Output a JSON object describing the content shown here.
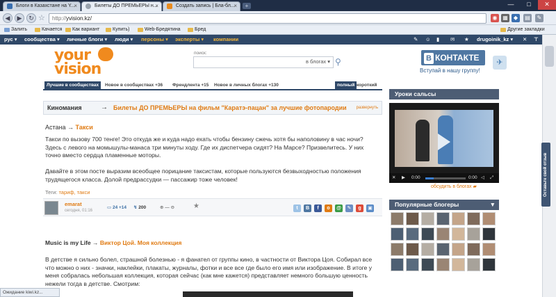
{
  "browser": {
    "tabs": [
      {
        "title": "Блоги в Казахстане на Y...",
        "active": false,
        "favicon_color": "#3a6fb0"
      },
      {
        "title": "Билеты ДО ПРЕМЬЕРЫ н...",
        "active": true,
        "favicon_color": "#9aa3ad"
      },
      {
        "title": "Создать запись | Бла-бл...",
        "active": false,
        "favicon_color": "#e98b1e"
      }
    ],
    "new_tab": "+",
    "window_controls": [
      "—",
      "□",
      "✕"
    ],
    "address": {
      "scheme": "http://",
      "host": "yvision.kz/"
    },
    "bookmarks": [
      "Залить",
      "Качается",
      "Как вариант",
      "Купить)",
      "Web-Бредятина",
      "Бред"
    ],
    "other_bookmarks": "Другие закладки",
    "status": "Ожидание kiwi.kz..."
  },
  "site_menu": {
    "lang": "рус",
    "items": [
      "сообщества",
      "личные блоги",
      "люди",
      "персоны",
      "эксперты",
      "компании"
    ],
    "user": "drugoinik_kz"
  },
  "header": {
    "logo_line1": "your",
    "logo_line2": "vision",
    "search_label": "поиск:",
    "search_scope": "в блогах",
    "vk_text": "КОНТАКТЕ",
    "vk_letter": "В",
    "vk_sub": "Вступай в нашу группу!"
  },
  "blog_tabs": [
    {
      "label": "Лучшие в сообществах",
      "count": "",
      "active": true
    },
    {
      "label": "Новое в сообществах",
      "count": "+36",
      "active": false
    },
    {
      "label": "Френдлента",
      "count": "+15",
      "active": false
    },
    {
      "label": "Новое в личных блогах",
      "count": "+130",
      "active": false
    },
    {
      "label": "полный",
      "count": "",
      "active": true
    },
    {
      "label": "короткий",
      "count": "",
      "active": false
    }
  ],
  "cinema": {
    "category": "Киномания",
    "arrow": "→",
    "title": "Билеты ДО ПРЕМЬЕРЫ на фильм \"Каратэ-пацан\" за лучшие фотопародии",
    "expand": "развернуть"
  },
  "post1": {
    "community": "Астана",
    "arrow": "→",
    "title": "Такси",
    "p1": "Такси по вызову 700 тенге! Это откуда же и куда надо ехать чтобы бензину сжечь хотя бы наполовину в час ночи? Здесь с левого на момышулы-манаса три минуты ходу. Где их диспетчера сидят? На Марсе? Призвелитесь. У них точно вместо сердца пламенные моторы.",
    "p2": "Давайте в этом посте выразим всеобщее порицание таксистам, которые пользуются безвыходностью положения трудящегося класса. Долой предрассудки — пассажир тоже человек!",
    "tags_label": "Теги:",
    "tags": "тариф, такси",
    "author": "emarat",
    "date": "сегодня, 01:16",
    "comments": "24 +14",
    "views": "200",
    "rating": "—"
  },
  "post2": {
    "community": "Music is my Life",
    "arrow": "→",
    "title": "Виктор Цой. Моя коллекция",
    "p1": "В детстве я сильно болел, страшной болезнью - я фанател от группы кино, в частности от Виктора Цоя. Собирал все что можно о них - значки, наклейки, плакаты, журналы, фотки и все все где было его имя или изображение. В итоге у меня собралась небольшая коллекция, которая сейчас (как мне кажется) представляет немного большую ценность нежели тогда в детстве. Смотрим:"
  },
  "sidebar": {
    "video_title": "Уроки сальсы",
    "video_time_start": "0:00",
    "video_time_end": "0:00",
    "video_progress": 0.2,
    "discuss": "обсудить в блогах",
    "popular_title": "Популярные блогеры"
  },
  "feedback": "Оставьте свой отзыв",
  "colors": {
    "brand_orange": "#f08a1e",
    "nav_blue": "#2f4868",
    "vk_blue": "#4f77a2"
  }
}
